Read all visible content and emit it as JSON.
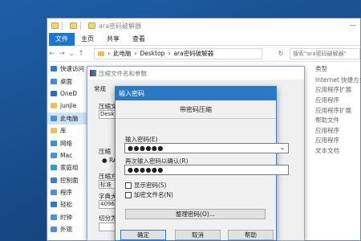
{
  "explorer": {
    "title": "ara密码破解器",
    "tabs": [
      "文件",
      "主页",
      "共享",
      "查看"
    ],
    "address": [
      "此电脑",
      "Desktop",
      "ara密码破解器"
    ],
    "search_placeholder": "搜索\"ara密码破解器\"",
    "nav_items": [
      {
        "label": "快速访问",
        "icon": "star-icon",
        "color": "#2b7bd6"
      },
      {
        "label": "桌面",
        "icon": "desktop-icon",
        "color": "#3a8fd9"
      },
      {
        "label": "OneD",
        "icon": "onedrive-icon",
        "color": "#2a6fbe"
      },
      {
        "label": "junjie",
        "icon": "user-folder-icon",
        "color": "#e8c15a"
      },
      {
        "label": "此电脑",
        "icon": "computer-icon",
        "color": "#4a90d9"
      },
      {
        "label": "库",
        "icon": "library-icon",
        "color": "#e8c15a"
      },
      {
        "label": "网络",
        "icon": "network-icon",
        "color": "#3a8fd9"
      },
      {
        "label": "Mac",
        "icon": "computer-icon",
        "color": "#4a90d9"
      },
      {
        "label": "家庭组",
        "icon": "homegroup-icon",
        "color": "#2aa0c0"
      },
      {
        "label": "控制面",
        "icon": "control-panel-icon",
        "color": "#3a7ec8"
      },
      {
        "label": "程序",
        "icon": "programs-icon",
        "color": "#4a90d9"
      },
      {
        "label": "轻松",
        "icon": "ease-access-icon",
        "color": "#2b7bd6"
      },
      {
        "label": "时钟",
        "icon": "clock-icon",
        "color": "#4a90d9"
      },
      {
        "label": "外观",
        "icon": "appearance-icon",
        "color": "#4a90d9"
      }
    ],
    "type_header": "类型",
    "types": [
      "Internet 快捷方式",
      "应用程序扩展",
      "应用程序",
      "应用程序扩展",
      "帮助文件",
      "应用程序",
      "应用程序",
      "文本文档"
    ]
  },
  "archive_dialog": {
    "title": "压缩文件名和参数",
    "tab": "常规",
    "labels": [
      "压缩文",
      "压缩",
      "压缩方",
      "标准",
      "字典大",
      "4096",
      "切分为"
    ],
    "path_value": "Deskt",
    "radio_label": "RA"
  },
  "password_dialog": {
    "title": "输入密码",
    "subtitle": "带密码压缩",
    "password_label": "输入密码(E)",
    "password_value": "●●●●●●",
    "confirm_label": "再次输入密码以确认(R)",
    "confirm_value": "●●●●●●",
    "show_password_label": "显示密码(S)",
    "encrypt_names_label": "加密文件名(N)",
    "organize_label": "整理密码(O)...",
    "ok_label": "确定",
    "cancel_label": "取消",
    "help_label": "帮助"
  }
}
